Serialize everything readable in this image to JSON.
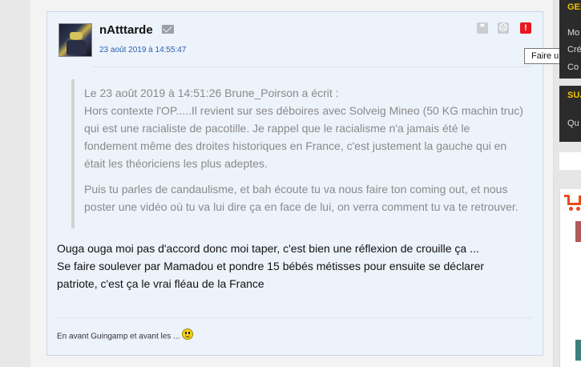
{
  "post": {
    "username": "nAtttarde",
    "date": "23 août 2019 à 14:55:47",
    "quote": {
      "lines_para1": [
        "Le 23 août 2019 à 14:51:26 Brune_Poirson a écrit :",
        "Hors contexte l'OP.....Il revient sur ses déboires avec Solveig Mineo (50 KG machin truc)",
        "qui est une racialiste de pacotille. Je rappel que le racialisme n'a jamais été le",
        "fondement même des droites historiques en France, c'est justement la gauche qui en",
        "était les théoriciens les plus adeptes."
      ],
      "lines_para2": [
        "Puis tu parles de candaulisme, et bah écoute tu va nous faire ton coming out, et nous",
        "poster une vidéo où tu va lui dire ça en face de lui, on verra comment tu va te retrouver."
      ]
    },
    "reply_lines": [
      "Ouga ouga moi pas d'accord donc moi taper, c'est bien une réflexion de crouille ça ...",
      "Se faire soulever par Mamadou et pondre 15 bébés métisses pour ensuite se déclarer",
      "patriote, c'est ça le vrai fléau de la France"
    ],
    "signature": "En avant Guingamp et avant les ...",
    "actions": {
      "quote_icon": "quote-icon",
      "sad_icon": "sad-face-icon",
      "report_icon": "report-icon",
      "quote_glyph": "❞",
      "sad_glyph": "☹",
      "report_glyph": "!"
    }
  },
  "tooltip": "Faire un signalement",
  "sidebar": {
    "section1_title": "GES",
    "section1_items": [
      "Mo",
      "Cré",
      "Co"
    ],
    "section2_title": "SUJ",
    "section2_items": [
      "Qu"
    ]
  },
  "colors": {
    "report": "#e8171e",
    "date_link": "#2a5db0",
    "sidebar_heading": "#f2c200",
    "cart": "#e84a1b"
  }
}
